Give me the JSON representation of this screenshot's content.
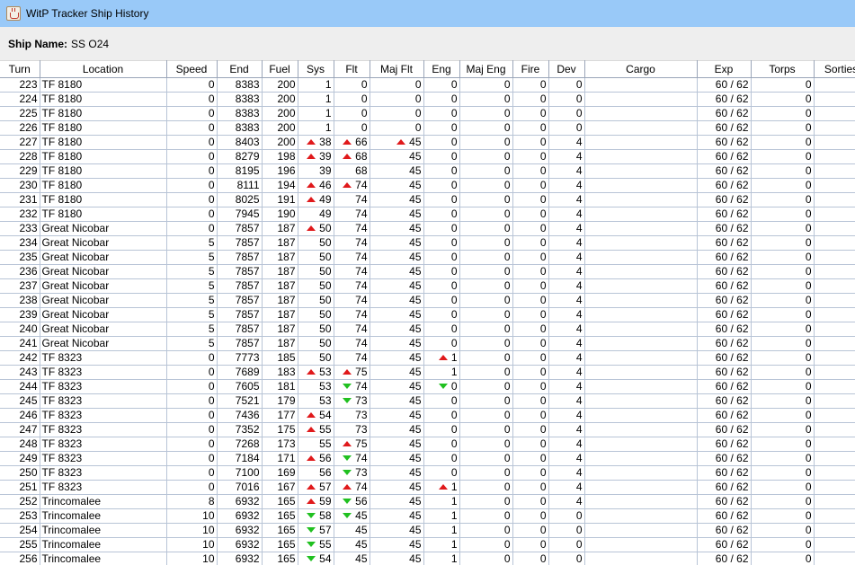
{
  "window": {
    "title": "WitP Tracker Ship History",
    "icon": "java-cup-icon"
  },
  "ship": {
    "label": "Ship Name:",
    "name": "SS O24"
  },
  "colors": {
    "titlebar": "#99c9f8",
    "up_arrow": "#e0191b",
    "down_arrow": "#20c020",
    "grid": "#b8c4d6"
  },
  "columns": [
    "Turn",
    "Location",
    "Speed",
    "End",
    "Fuel",
    "Sys",
    "Flt",
    "Maj Flt",
    "Eng",
    "Maj Eng",
    "Fire",
    "Dev",
    "Cargo",
    "Exp",
    "Torps",
    "Sorties"
  ],
  "rows": [
    [
      "223",
      "TF 8180",
      "0",
      "8383",
      "200",
      "1",
      "0",
      "0",
      "0",
      "0",
      "0",
      "0",
      "",
      "60 / 62",
      "0",
      "0"
    ],
    [
      "224",
      "TF 8180",
      "0",
      "8383",
      "200",
      "1",
      "0",
      "0",
      "0",
      "0",
      "0",
      "0",
      "",
      "60 / 62",
      "0",
      "0"
    ],
    [
      "225",
      "TF 8180",
      "0",
      "8383",
      "200",
      "1",
      "0",
      "0",
      "0",
      "0",
      "0",
      "0",
      "",
      "60 / 62",
      "0",
      "0"
    ],
    [
      "226",
      "TF 8180",
      "0",
      "8383",
      "200",
      "1",
      "0",
      "0",
      "0",
      "0",
      "0",
      "0",
      "",
      "60 / 62",
      "0",
      "0"
    ],
    [
      "227",
      "TF 8180",
      "0",
      "8403",
      "200",
      "^38",
      "^66",
      "^45",
      "0",
      "0",
      "0",
      "4",
      "",
      "60 / 62",
      "0",
      "0"
    ],
    [
      "228",
      "TF 8180",
      "0",
      "8279",
      "198",
      "^39",
      "^68",
      "45",
      "0",
      "0",
      "0",
      "4",
      "",
      "60 / 62",
      "0",
      "0"
    ],
    [
      "229",
      "TF 8180",
      "0",
      "8195",
      "196",
      "39",
      "68",
      "45",
      "0",
      "0",
      "0",
      "4",
      "",
      "60 / 62",
      "0",
      "0"
    ],
    [
      "230",
      "TF 8180",
      "0",
      "8111",
      "194",
      "^46",
      "^74",
      "45",
      "0",
      "0",
      "0",
      "4",
      "",
      "60 / 62",
      "0",
      "0"
    ],
    [
      "231",
      "TF 8180",
      "0",
      "8025",
      "191",
      "^49",
      "74",
      "45",
      "0",
      "0",
      "0",
      "4",
      "",
      "60 / 62",
      "0",
      "0"
    ],
    [
      "232",
      "TF 8180",
      "0",
      "7945",
      "190",
      "49",
      "74",
      "45",
      "0",
      "0",
      "0",
      "4",
      "",
      "60 / 62",
      "0",
      "0"
    ],
    [
      "233",
      "Great Nicobar",
      "0",
      "7857",
      "187",
      "^50",
      "74",
      "45",
      "0",
      "0",
      "0",
      "4",
      "",
      "60 / 62",
      "0",
      "0"
    ],
    [
      "234",
      "Great Nicobar",
      "5",
      "7857",
      "187",
      "50",
      "74",
      "45",
      "0",
      "0",
      "0",
      "4",
      "",
      "60 / 62",
      "0",
      "0"
    ],
    [
      "235",
      "Great Nicobar",
      "5",
      "7857",
      "187",
      "50",
      "74",
      "45",
      "0",
      "0",
      "0",
      "4",
      "",
      "60 / 62",
      "0",
      "0"
    ],
    [
      "236",
      "Great Nicobar",
      "5",
      "7857",
      "187",
      "50",
      "74",
      "45",
      "0",
      "0",
      "0",
      "4",
      "",
      "60 / 62",
      "0",
      "0"
    ],
    [
      "237",
      "Great Nicobar",
      "5",
      "7857",
      "187",
      "50",
      "74",
      "45",
      "0",
      "0",
      "0",
      "4",
      "",
      "60 / 62",
      "0",
      "0"
    ],
    [
      "238",
      "Great Nicobar",
      "5",
      "7857",
      "187",
      "50",
      "74",
      "45",
      "0",
      "0",
      "0",
      "4",
      "",
      "60 / 62",
      "0",
      "0"
    ],
    [
      "239",
      "Great Nicobar",
      "5",
      "7857",
      "187",
      "50",
      "74",
      "45",
      "0",
      "0",
      "0",
      "4",
      "",
      "60 / 62",
      "0",
      "0"
    ],
    [
      "240",
      "Great Nicobar",
      "5",
      "7857",
      "187",
      "50",
      "74",
      "45",
      "0",
      "0",
      "0",
      "4",
      "",
      "60 / 62",
      "0",
      "0"
    ],
    [
      "241",
      "Great Nicobar",
      "5",
      "7857",
      "187",
      "50",
      "74",
      "45",
      "0",
      "0",
      "0",
      "4",
      "",
      "60 / 62",
      "0",
      "0"
    ],
    [
      "242",
      "TF 8323",
      "0",
      "7773",
      "185",
      "50",
      "74",
      "45",
      "^1",
      "0",
      "0",
      "4",
      "",
      "60 / 62",
      "0",
      "0"
    ],
    [
      "243",
      "TF 8323",
      "0",
      "7689",
      "183",
      "^53",
      "^75",
      "45",
      "1",
      "0",
      "0",
      "4",
      "",
      "60 / 62",
      "0",
      "0"
    ],
    [
      "244",
      "TF 8323",
      "0",
      "7605",
      "181",
      "53",
      "v74",
      "45",
      "v0",
      "0",
      "0",
      "4",
      "",
      "60 / 62",
      "0",
      "0"
    ],
    [
      "245",
      "TF 8323",
      "0",
      "7521",
      "179",
      "53",
      "v73",
      "45",
      "0",
      "0",
      "0",
      "4",
      "",
      "60 / 62",
      "0",
      "0"
    ],
    [
      "246",
      "TF 8323",
      "0",
      "7436",
      "177",
      "^54",
      "73",
      "45",
      "0",
      "0",
      "0",
      "4",
      "",
      "60 / 62",
      "0",
      "0"
    ],
    [
      "247",
      "TF 8323",
      "0",
      "7352",
      "175",
      "^55",
      "73",
      "45",
      "0",
      "0",
      "0",
      "4",
      "",
      "60 / 62",
      "0",
      "0"
    ],
    [
      "248",
      "TF 8323",
      "0",
      "7268",
      "173",
      "55",
      "^75",
      "45",
      "0",
      "0",
      "0",
      "4",
      "",
      "60 / 62",
      "0",
      "0"
    ],
    [
      "249",
      "TF 8323",
      "0",
      "7184",
      "171",
      "^56",
      "v74",
      "45",
      "0",
      "0",
      "0",
      "4",
      "",
      "60 / 62",
      "0",
      "0"
    ],
    [
      "250",
      "TF 8323",
      "0",
      "7100",
      "169",
      "56",
      "v73",
      "45",
      "0",
      "0",
      "0",
      "4",
      "",
      "60 / 62",
      "0",
      "0"
    ],
    [
      "251",
      "TF 8323",
      "0",
      "7016",
      "167",
      "^57",
      "^74",
      "45",
      "^1",
      "0",
      "0",
      "4",
      "",
      "60 / 62",
      "0",
      "0"
    ],
    [
      "252",
      "Trincomalee",
      "8",
      "6932",
      "165",
      "^59",
      "v56",
      "45",
      "1",
      "0",
      "0",
      "4",
      "",
      "60 / 62",
      "0",
      "0"
    ],
    [
      "253",
      "Trincomalee",
      "10",
      "6932",
      "165",
      "v58",
      "v45",
      "45",
      "1",
      "0",
      "0",
      "0",
      "",
      "60 / 62",
      "0",
      "0"
    ],
    [
      "254",
      "Trincomalee",
      "10",
      "6932",
      "165",
      "v57",
      "45",
      "45",
      "1",
      "0",
      "0",
      "0",
      "",
      "60 / 62",
      "0",
      "0"
    ],
    [
      "255",
      "Trincomalee",
      "10",
      "6932",
      "165",
      "v55",
      "45",
      "45",
      "1",
      "0",
      "0",
      "0",
      "",
      "60 / 62",
      "0",
      "0"
    ],
    [
      "256",
      "Trincomalee",
      "10",
      "6932",
      "165",
      "v54",
      "45",
      "45",
      "1",
      "0",
      "0",
      "0",
      "",
      "60 / 62",
      "0",
      "0"
    ]
  ]
}
